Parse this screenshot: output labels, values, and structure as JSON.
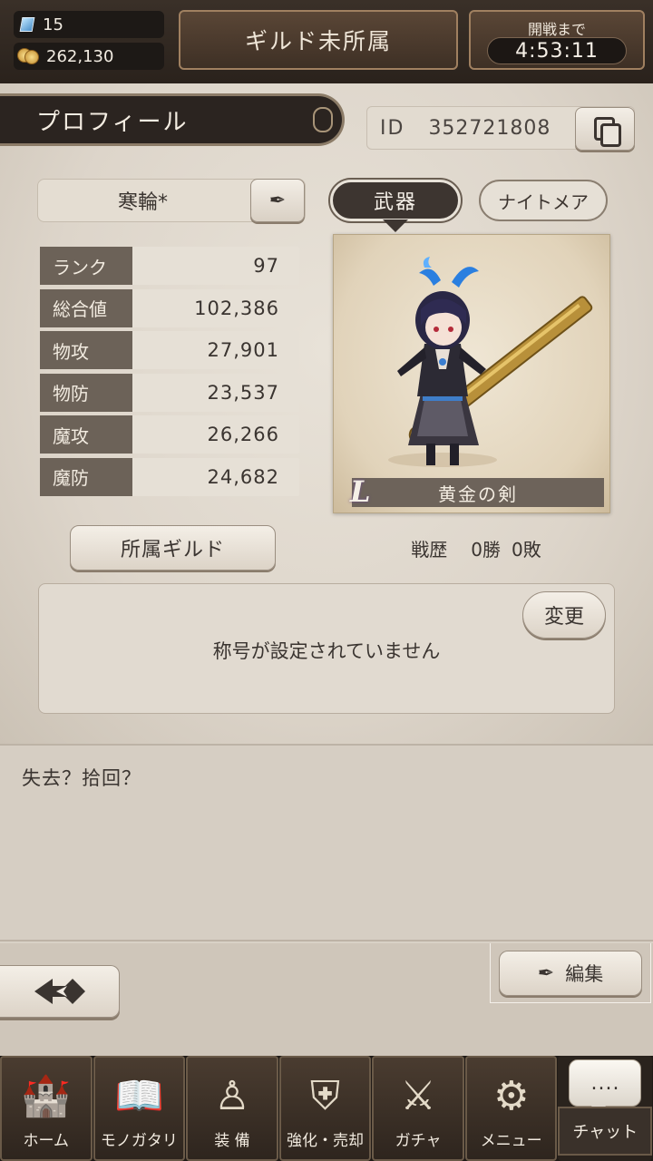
{
  "top": {
    "gems": "15",
    "gold": "262,130",
    "guild_status": "ギルド未所属",
    "battle_label": "開戦まで",
    "battle_timer": "4:53:11"
  },
  "profile": {
    "tab_title": "プロフィール",
    "id_label": "ID",
    "id_value": "352721808",
    "name": "寒輪*",
    "stats": [
      {
        "label": "ランク",
        "value": "97"
      },
      {
        "label": "総合値",
        "value": "102,386"
      },
      {
        "label": "物攻",
        "value": "27,901"
      },
      {
        "label": "物防",
        "value": "23,537"
      },
      {
        "label": "魔攻",
        "value": "26,266"
      },
      {
        "label": "魔防",
        "value": "24,682"
      }
    ],
    "tabs": {
      "weapon": "武器",
      "nightmare": "ナイトメア"
    },
    "weapon": {
      "rarity": "L",
      "name": "黄金の剣"
    },
    "guild_button": "所属ギルド",
    "record": {
      "label": "戦歴",
      "wins": "0勝",
      "losses": "0敗"
    },
    "title_text": "称号が設定されていません",
    "change_button": "変更"
  },
  "comment": "失去？拾回？",
  "edit_button": "編集",
  "icons": {
    "back": "back-arrow-icon",
    "edit": "pen-icon",
    "copy": "copy-icon"
  },
  "nav": [
    {
      "label": "ホーム",
      "icon": "castle-icon"
    },
    {
      "label": "モノガタリ",
      "icon": "book-icon"
    },
    {
      "label": "装 備",
      "icon": "puppet-icon"
    },
    {
      "label": "強化・売却",
      "icon": "helmet-icon"
    },
    {
      "label": "ガチャ",
      "icon": "swords-icon"
    },
    {
      "label": "メニュー",
      "icon": "gears-icon"
    }
  ],
  "chat": {
    "bubble": "....",
    "label": "チャット"
  }
}
